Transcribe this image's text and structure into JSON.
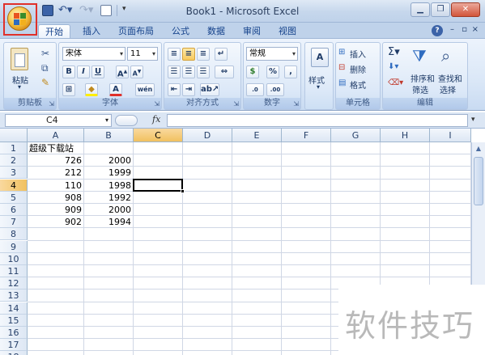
{
  "window": {
    "title": "Book1 - Microsoft Excel"
  },
  "qat": {
    "save_icon": "save-icon",
    "undo_icon": "undo-icon",
    "redo_icon": "redo-icon",
    "print_preview_icon": "print-preview-icon"
  },
  "tabs": [
    {
      "label": "开始",
      "active": true
    },
    {
      "label": "插入"
    },
    {
      "label": "页面布局"
    },
    {
      "label": "公式"
    },
    {
      "label": "数据"
    },
    {
      "label": "审阅"
    },
    {
      "label": "视图"
    }
  ],
  "ribbon": {
    "clipboard": {
      "paste_label": "粘贴",
      "group_label": "剪贴板"
    },
    "font": {
      "font_name": "宋体",
      "font_size": "11",
      "group_label": "字体"
    },
    "alignment": {
      "group_label": "对齐方式"
    },
    "number": {
      "format": "常规",
      "group_label": "数字"
    },
    "styles": {
      "label": "样式"
    },
    "cells": {
      "insert": "插入",
      "delete": "删除",
      "format": "格式",
      "group_label": "单元格"
    },
    "editing": {
      "sort_filter_line1": "排序和",
      "sort_filter_line2": "筛选",
      "find_select_line1": "查找和",
      "find_select_line2": "选择",
      "group_label": "编辑"
    }
  },
  "formula_bar": {
    "name_box": "C4",
    "fx": "fx",
    "value": ""
  },
  "sheet": {
    "columns": [
      "A",
      "B",
      "C",
      "D",
      "E",
      "F",
      "G",
      "H",
      "I"
    ],
    "selected_column": "C",
    "rows": [
      "1",
      "2",
      "3",
      "4",
      "5",
      "6",
      "7",
      "8",
      "9",
      "10",
      "11",
      "12",
      "13",
      "14",
      "15",
      "16",
      "17",
      "18"
    ],
    "selected_row": "4",
    "cells": [
      {
        "ref": "A1",
        "value": "超级下载站"
      },
      {
        "ref": "A2",
        "value": "726"
      },
      {
        "ref": "B2",
        "value": "2000"
      },
      {
        "ref": "A3",
        "value": "212"
      },
      {
        "ref": "B3",
        "value": "1999"
      },
      {
        "ref": "A4",
        "value": "110"
      },
      {
        "ref": "B4",
        "value": "1998"
      },
      {
        "ref": "A5",
        "value": "908"
      },
      {
        "ref": "B5",
        "value": "1992"
      },
      {
        "ref": "A6",
        "value": "909"
      },
      {
        "ref": "B6",
        "value": "2000"
      },
      {
        "ref": "A7",
        "value": "902"
      },
      {
        "ref": "B7",
        "value": "1994"
      }
    ],
    "active_cell": "C4"
  },
  "watermark": {
    "text": "软件技巧"
  },
  "colors": {
    "accent": "#15428b",
    "highlight": "#f1c15f",
    "office_button_frame": "#e0302a"
  }
}
